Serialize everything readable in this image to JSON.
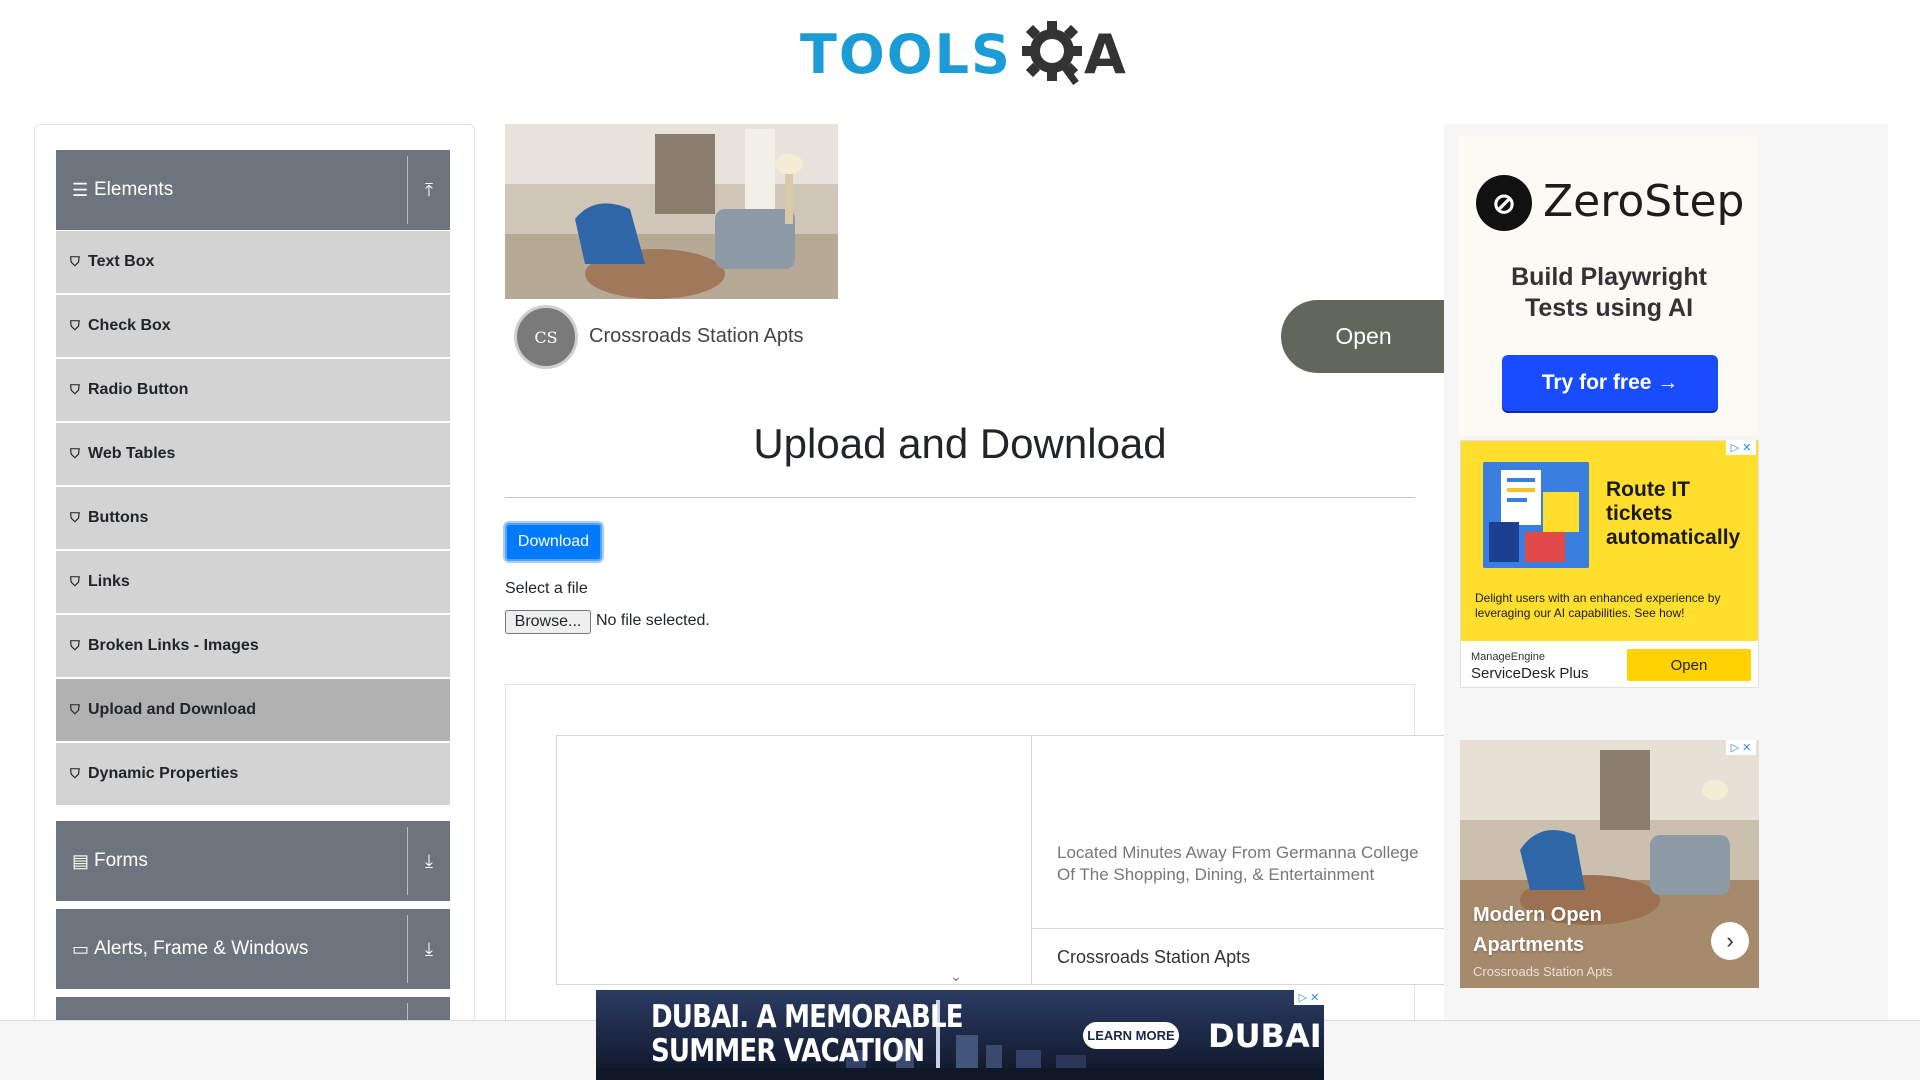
{
  "header": {
    "logo_tools": "TOOLS",
    "logo_a": "A"
  },
  "sidebar": {
    "groups": [
      {
        "label": "Elements",
        "icon": "menu-icon",
        "toggle": "collapse-up-icon"
      },
      {
        "label": "Forms",
        "icon": "document-icon",
        "toggle": "expand-down-icon"
      },
      {
        "label": "Alerts, Frame & Windows",
        "icon": "window-icon",
        "toggle": "expand-down-icon"
      }
    ],
    "items": [
      {
        "label": "Text Box"
      },
      {
        "label": "Check Box"
      },
      {
        "label": "Radio Button"
      },
      {
        "label": "Web Tables"
      },
      {
        "label": "Buttons"
      },
      {
        "label": "Links"
      },
      {
        "label": "Broken Links - Images"
      },
      {
        "label": "Upload and Download",
        "active": true
      },
      {
        "label": "Dynamic Properties"
      }
    ]
  },
  "top_ad": {
    "name": "Crossroads Station Apts",
    "open_label": "Open",
    "logo_text": "CS"
  },
  "main": {
    "title": "Upload and Download",
    "download_label": "Download",
    "select_label": "Select a file",
    "browse_label": "Browse...",
    "file_status": "No file selected."
  },
  "content_ad": {
    "line1": "Located Minutes Away From Germanna College",
    "line2": "Of The Shopping, Dining, & Entertainment",
    "name": "Crossroads Station Apts"
  },
  "right_ads": {
    "zerostep": {
      "name": "ZeroStep",
      "tagline_1": "Build Playwright",
      "tagline_2": "Tests using AI",
      "cta": "Try for free →"
    },
    "manageengine": {
      "title_1": "Route IT",
      "title_2": "tickets",
      "title_3": "automatically",
      "desc": "Delight users with an enhanced experience by leveraging our AI capabilities. See how!",
      "brand_small": "ManageEngine",
      "brand_product": "ServiceDesk Plus",
      "open_label": "Open"
    },
    "apartments": {
      "title_1": "Modern Open",
      "title_2": "Apartments",
      "sub": "Crossroads Station Apts"
    }
  },
  "bottom_ad": {
    "line1": "DUBAI. A MEMORABLE",
    "line2": "SUMMER VACATION",
    "cta": "LEARN MORE",
    "brand": "DUBAI"
  },
  "colors": {
    "accent": "#007bff",
    "sidebar_header": "#6c757d",
    "sidebar_item": "#d3d3d3",
    "sidebar_active": "#b1b1b1",
    "logo_blue": "#1b9cd6"
  }
}
